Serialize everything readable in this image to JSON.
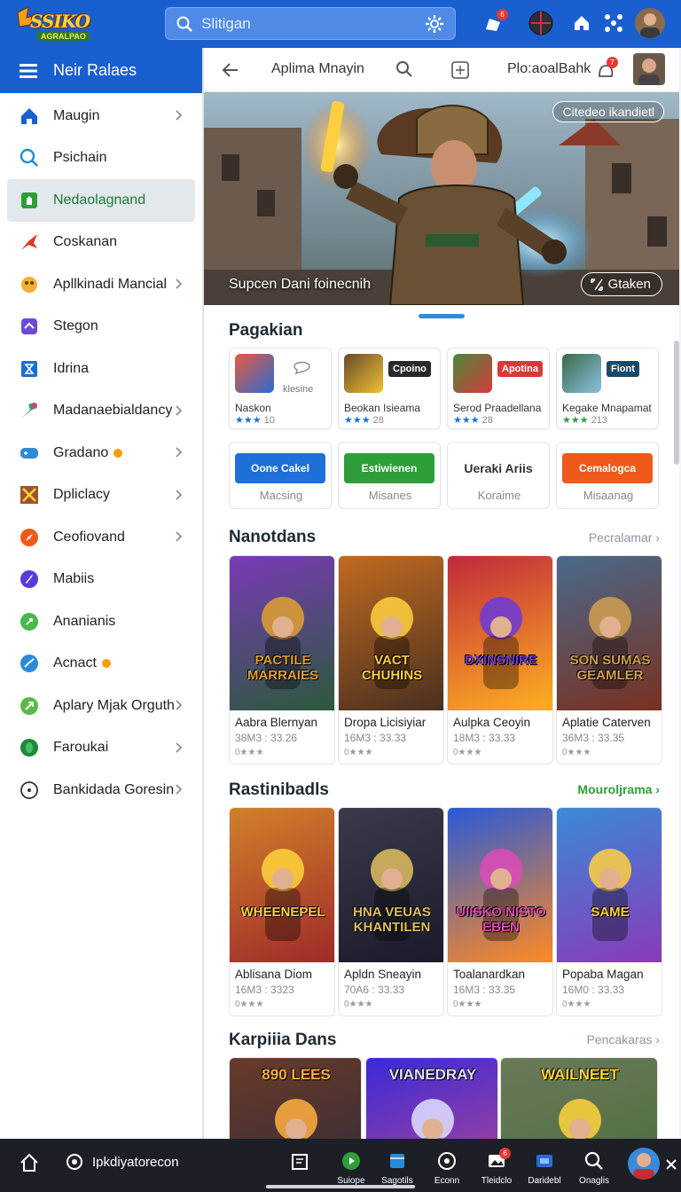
{
  "topbar": {
    "logo_text": "SSIKO",
    "logo_sub": "AGRALPAO",
    "search_placeholder": "Slitigan",
    "notif_badge": "6",
    "colors": {
      "bar": "#1a5fcf",
      "accent": "#2e9e3a"
    }
  },
  "sidebar": {
    "header": "Neir Ralaes",
    "items": [
      {
        "label": "Maugin",
        "icon": "home-icon",
        "chevron": true
      },
      {
        "label": "Psichain",
        "icon": "search-icon",
        "chevron": false
      },
      {
        "label": "Nedaolagnand",
        "icon": "shop-icon",
        "chevron": false,
        "active": true
      },
      {
        "label": "Coskanan",
        "icon": "leaf-icon",
        "chevron": false
      },
      {
        "label": "Apllkinadi Mancial",
        "icon": "mask-icon",
        "chevron": true
      },
      {
        "label": "Stegon",
        "icon": "puzzle-icon",
        "chevron": false
      },
      {
        "label": "Idrina",
        "icon": "hourglass-icon",
        "chevron": false
      },
      {
        "label": "Madanaebialdancy",
        "icon": "tools-icon",
        "chevron": true
      },
      {
        "label": "Gradano",
        "icon": "controller-icon",
        "chevron": true,
        "dot": true
      },
      {
        "label": "Dpliclacy",
        "icon": "crossed-swords-icon",
        "chevron": true
      },
      {
        "label": "Ceofiovand",
        "icon": "compass-icon",
        "chevron": true
      },
      {
        "label": "Mabiis",
        "icon": "rocket-icon",
        "chevron": false
      },
      {
        "label": "Ananianis",
        "icon": "music-icon",
        "chevron": false
      },
      {
        "label": "Acnact",
        "icon": "chart-icon",
        "chevron": false,
        "dot": true
      },
      {
        "label": "Aplary Mjak Orguth",
        "icon": "star-icon",
        "chevron": true
      },
      {
        "label": "Faroukai",
        "icon": "globe-icon",
        "chevron": true
      },
      {
        "label": "Bankidada Goresin",
        "icon": "clock-icon",
        "chevron": true
      }
    ]
  },
  "content_top": {
    "title": "Aplima Mnayin",
    "right_label": "Plo:aoalBahk",
    "badge": "7"
  },
  "hero": {
    "caption": "Supcen Dani foinecnih",
    "button": "Gtaken",
    "tag": "Citedeo ikandietl"
  },
  "section_apps": {
    "title": "Pagakian",
    "cards": [
      {
        "name": "Naskon",
        "rating": "10",
        "extra": "klesine",
        "stars": "★★★"
      },
      {
        "name": "Beokan Isieama",
        "rating": "28",
        "extra": "Cpoino",
        "stars": "★★★"
      },
      {
        "name": "Serod Praadellana",
        "rating": "28",
        "extra": "Apotina",
        "stars": "★★★"
      },
      {
        "name": "Kegake Mnapamat",
        "rating": "213",
        "extra": "Fiont",
        "stars": "★★★"
      }
    ],
    "buttons": [
      {
        "btn": "Oone Cakel",
        "label": "Macsing",
        "color": "#1e6fd9"
      },
      {
        "btn": "Estiwienen",
        "label": "Misanes",
        "color": "#2e9e3a"
      },
      {
        "btn": "Ueraki Ariis",
        "label": "Koraime",
        "color": "#ffffff"
      },
      {
        "btn": "Cemalogca",
        "label": "Misaanag",
        "color": "#ef5a1a"
      }
    ]
  },
  "section_new": {
    "title": "Nanotdans",
    "link": "Pecralamar",
    "games": [
      {
        "title": "Aabra Blernyan",
        "size": "38M3 : 33.26",
        "art_text": "PACTILE MARRAIES",
        "rating": "0★★★"
      },
      {
        "title": "Dropa Licisiyiar",
        "size": "16M3 : 33.33",
        "art_text": "VACT CHUHINS",
        "rating": "0★★★"
      },
      {
        "title": "Aulpka Ceoyin",
        "size": "18M3 : 33.33",
        "art_text": "DXINSNIRE",
        "rating": "0★★★"
      },
      {
        "title": "Aplatie Caterven",
        "size": "36M3 : 33.35",
        "art_text": "SON SUMAS GEAMLER",
        "rating": "0★★★"
      }
    ]
  },
  "section_rank": {
    "title": "Rastinibadls",
    "link": "Mouroljrama",
    "games": [
      {
        "title": "Ablisana Diom",
        "size": "16M3 : 3323",
        "art_text": "WHEENEPEL",
        "rating": "0★★★"
      },
      {
        "title": "Apldn Sneayin",
        "size": "70A6 : 33.33",
        "art_text": "HNA VEUAS KHANTILEN",
        "rating": "0★★★"
      },
      {
        "title": "Toalanardkan",
        "size": "16M3 : 33.35",
        "art_text": "UIISKO NISTO EBEN",
        "rating": "0★★★"
      },
      {
        "title": "Popaba Magan",
        "size": "16M0 : 33.33",
        "art_text": "SAME",
        "rating": "0★★★"
      }
    ]
  },
  "section_more": {
    "title": "Karpiiia Dans",
    "link": "Pencakaras",
    "games": [
      {
        "art_text": "890 LEES"
      },
      {
        "art_text": "VIANEDRAY"
      },
      {
        "art_text": "WAILNEET"
      }
    ]
  },
  "bottombar": {
    "site": "Ipkdiyatorecon",
    "items": [
      {
        "label": "Suiope",
        "icon": "play-circle-icon"
      },
      {
        "label": "Sagotils",
        "icon": "cube-icon"
      },
      {
        "label": "Econn",
        "icon": "record-icon"
      },
      {
        "label": "Tleidclo",
        "icon": "photo-icon",
        "badge": "6"
      },
      {
        "label": "Daridebl",
        "icon": "tv-icon"
      },
      {
        "label": "Onaglis",
        "icon": "search-icon"
      }
    ]
  }
}
